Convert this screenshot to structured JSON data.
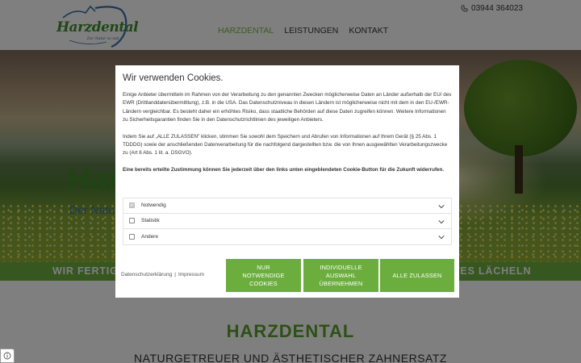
{
  "header": {
    "logo_text": "Harzdental",
    "logo_tagline": "Der Natur so nah",
    "phone": "03944 364023",
    "nav": [
      {
        "label": "HARZDENTAL",
        "active": true
      },
      {
        "label": "LEISTUNGEN",
        "active": false
      },
      {
        "label": "KONTAKT",
        "active": false
      }
    ]
  },
  "hero": {
    "title": "Harzdental",
    "subtitle": "Der Natur so nah",
    "band_left": "WIR FERTIGEN",
    "band_right": "TES LÄCHELN"
  },
  "lower": {
    "title": "HARZDENTAL",
    "subtitle": "NATURGETREUER UND ÄSTHETISCHER ZAHNERSATZ"
  },
  "cookie_dialog": {
    "title": "Wir verwenden Cookies.",
    "paragraph1": "Einige Anbieter übermitteln im Rahmen von der Verarbeitung zu den genannten Zwecken möglicherweise Daten an Länder außerhalb der EU/ des EWR (Drittlanddatenübermittlung), z.B. in die USA. Das Datenschutzniveau in diesen Ländern ist möglicherweise nicht mit dem in den EU-/EWR-Ländern vergleichbar. Es besteht daher ein erhöhtes Risiko, dass staatliche Behörden auf diese Daten zugreifen können. Weitere Informationen zu Sicherheitsgarantien finden Sie in den Datenschutzrichtlinien des jeweiligen Anbieters.",
    "paragraph2": "Indem Sie auf „ALLE ZULASSEN\" klicken, stimmen Sie sowohl dem Speichern und Abrufen von Informationen auf Ihrem Gerät (§ 25 Abs. 1 TDDDG) sowie der anschließenden Datenverarbeitung für die nachfolgend dargestellten bzw. die von Ihnen ausgewählten Verarbeitungszwecke zu (Art 6 Abs. 1 lit. a. DSGVO).",
    "paragraph3": "Eine bereits erteilte Zustimmung können Sie jederzeit über den links unten eingeblendeten Cookie-Button für die Zukunft widerrufen.",
    "categories": [
      {
        "label": "Notwendig",
        "checked": true
      },
      {
        "label": "Statistik",
        "checked": false
      },
      {
        "label": "Andere",
        "checked": false
      }
    ],
    "link_privacy": "Datenschutzerklärung",
    "link_separator": "|",
    "link_imprint": "Impressum",
    "btn_necessary": "NUR NOTWENDIGE COOKIES",
    "btn_individual": "INDIVIDUELLE AUSWAHL ÜBERNEHMEN",
    "btn_all": "ALLE ZULASSEN"
  },
  "colors": {
    "brand_green": "#6cae3e",
    "nav_active": "#7ab648"
  }
}
